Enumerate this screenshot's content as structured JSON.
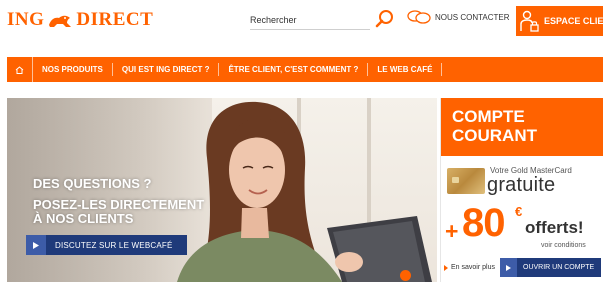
{
  "brand": {
    "name_left": "ING",
    "name_right": "DIRECT",
    "accent": "#ff6200",
    "navy": "#1f3a7a",
    "logo_icon": "lion-icon"
  },
  "header": {
    "search_placeholder": "Rechercher",
    "search_icon": "search-icon",
    "contact_label": "NOUS CONTACTER",
    "contact_icon": "chat-bubbles-icon",
    "espace_label": "ESPACE CLIENT",
    "espace_icon": "user-lock-icon"
  },
  "nav": {
    "home_icon": "home-icon",
    "items": [
      "NOS PRODUITS",
      "QUI EST ING DIRECT ?",
      "ÊTRE CLIENT, C'EST COMMENT ?",
      "LE WEB CAFÉ"
    ]
  },
  "hero": {
    "line1": "DES QUESTIONS ?",
    "line2": "POSEZ-LES DIRECTEMENT",
    "line3": "À NOS CLIENTS",
    "cta_label": "DISCUTEZ SUR LE WEBCAFÉ",
    "cta_icon": "play-arrow-icon",
    "carousel_dot": "carousel-dot"
  },
  "promo": {
    "title_line1": "COMPTE",
    "title_line2": "COURANT",
    "card_title": "Votre Gold MasterCard",
    "card_free": "gratuite",
    "plus": "+",
    "amount": "80",
    "currency": "€",
    "offerts": "offerts!",
    "conditions": "voir conditions",
    "more_link": "En savoir plus",
    "open_label": "OUVRIR UN COMPTE"
  }
}
